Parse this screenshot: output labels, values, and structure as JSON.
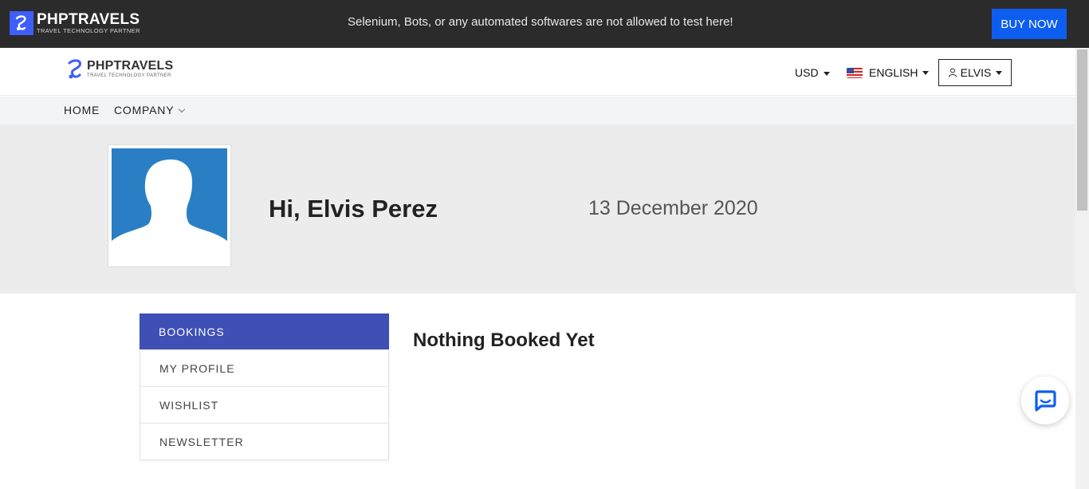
{
  "promo_bar": {
    "brand_name": "PHPTRAVELS",
    "brand_tagline": "TRAVEL TECHNOLOGY PARTNER",
    "notice": "Selenium, Bots, or any automated softwares are not allowed to test here!",
    "buy_label": "BUY NOW",
    "background_color": "#2b2b2b",
    "buy_color": "#0d5ef0"
  },
  "header": {
    "brand_name": "PHPTRAVELS",
    "brand_tagline": "TRAVEL TECHNOLOGY PARTNER",
    "currency": "USD",
    "language": "ENGLISH",
    "user_label": "ELVIS"
  },
  "nav": {
    "items": [
      {
        "label": "HOME",
        "icon": ""
      },
      {
        "label": "COMPANY",
        "icon": "chevron-down-icon"
      }
    ]
  },
  "profile": {
    "greeting": "Hi, Elvis Perez",
    "date": "13 December 2020",
    "avatar_icon": "user-silhouette-icon",
    "avatar_color": "#2a7fc4"
  },
  "sidebar": {
    "active_color": "#3e4fb5",
    "items": [
      {
        "label": "BOOKINGS",
        "active": true
      },
      {
        "label": "MY PROFILE",
        "active": false
      },
      {
        "label": "WISHLIST",
        "active": false
      },
      {
        "label": "NEWSLETTER",
        "active": false
      }
    ]
  },
  "main": {
    "empty_message": "Nothing Booked Yet"
  },
  "chat_widget": {
    "icon": "chat-bubble-icon",
    "color": "#0d5ef0"
  }
}
